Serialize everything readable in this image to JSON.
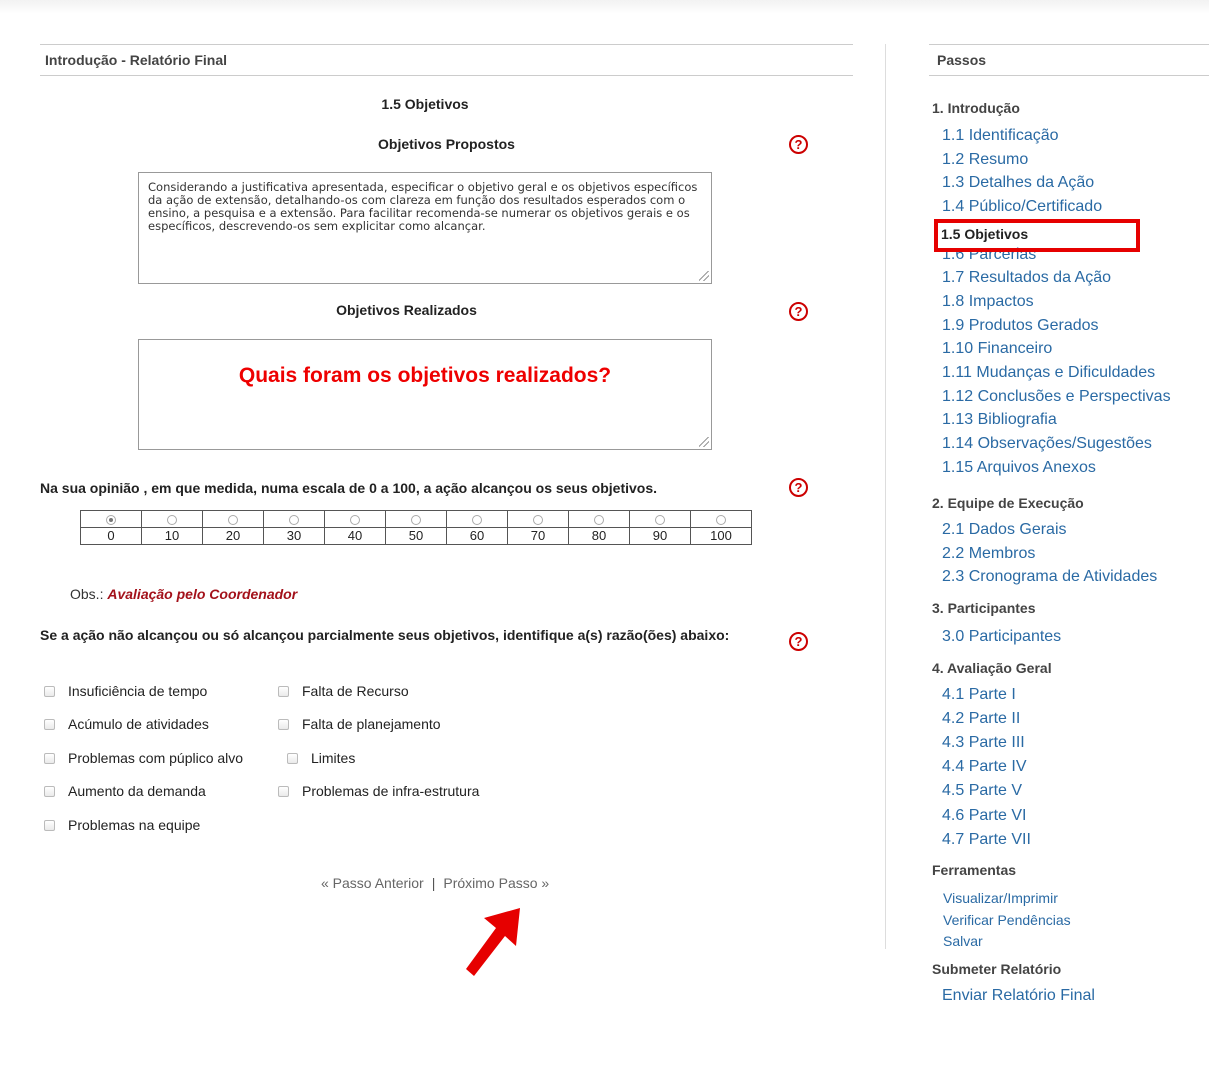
{
  "main": {
    "title": "Introdução - Relatório Final",
    "section_title": "1.5 Objetivos",
    "proposed_title": "Objetivos Propostos",
    "proposed_text": "Considerando a justificativa apresentada, especificar o objetivo geral e os objetivos específicos da ação de extensão, detalhando-os com clareza em função dos resultados esperados com o ensino, a pesquisa e a extensão. Para facilitar recomenda-se numerar os objetivos gerais e os específicos, descrevendo-os sem explicitar como alcançar.",
    "realized_title": "Objetivos Realizados",
    "realized_annotation": "Quais foram os objetivos realizados?",
    "scale_question": "Na sua opinião , em que medida, numa escala de 0 a 100, a ação alcançou os seus objetivos.",
    "scale_options": [
      "0",
      "10",
      "20",
      "30",
      "40",
      "50",
      "60",
      "70",
      "80",
      "90",
      "100"
    ],
    "scale_selected": "0",
    "obs_label": "Obs.:",
    "obs_value": "Avaliação pelo Coordenador",
    "reasons_question": "Se a ação não alcançou ou só alcançou parcialmente seus objetivos, identifique a(s) razão(ões) abaixo:",
    "reasons_left": [
      "Insuficiência de tempo",
      "Acúmulo de atividades",
      "Problemas com púplico alvo",
      "Aumento da demanda",
      "Problemas na equipe"
    ],
    "reasons_right": [
      "Falta de Recurso",
      "Falta de planejamento",
      "Limites",
      "Problemas de infra-estrutura"
    ],
    "prev_label": "« Passo Anterior",
    "separator": "|",
    "next_label": "Próximo Passo »",
    "help_glyph": "?",
    "help_icon": "question-circle-icon",
    "annotation_color": "#e60000"
  },
  "sidebar": {
    "title": "Passos",
    "groups": [
      {
        "label": "1. Introdução",
        "items": [
          "1.1 Identificação",
          "1.2 Resumo",
          "1.3 Detalhes da Ação",
          "1.4 Público/Certificado",
          "1.5 Objetivos",
          "1.6 Parcerias",
          "1.7 Resultados da Ação",
          "1.8 Impactos",
          "1.9 Produtos Gerados",
          "1.10 Financeiro",
          "1.11 Mudanças e Dificuldades",
          "1.12 Conclusões e Perspectivas",
          "1.13 Bibliografia",
          "1.14 Observações/Sugestões",
          "1.15 Arquivos Anexos"
        ]
      },
      {
        "label": "2. Equipe de Execução",
        "items": [
          "2.1 Dados Gerais",
          "2.2 Membros",
          "2.3 Cronograma de Atividades"
        ]
      },
      {
        "label": "3. Participantes",
        "items": [
          "3.0 Participantes"
        ]
      },
      {
        "label": "4. Avaliação Geral",
        "items": [
          "4.1 Parte I",
          "4.2 Parte II",
          "4.3 Parte III",
          "4.4 Parte IV",
          "4.5 Parte V",
          "4.6 Parte VI",
          "4.7 Parte VII"
        ]
      },
      {
        "label": "Ferramentas",
        "items": [
          "Visualizar/Imprimir",
          "Verificar Pendências",
          "Salvar"
        ]
      },
      {
        "label": "Submeter Relatório",
        "items": [
          "Enviar Relatório Final"
        ]
      }
    ],
    "active_item": "1.5 Objetivos",
    "link_color": "#2a6aa4"
  }
}
